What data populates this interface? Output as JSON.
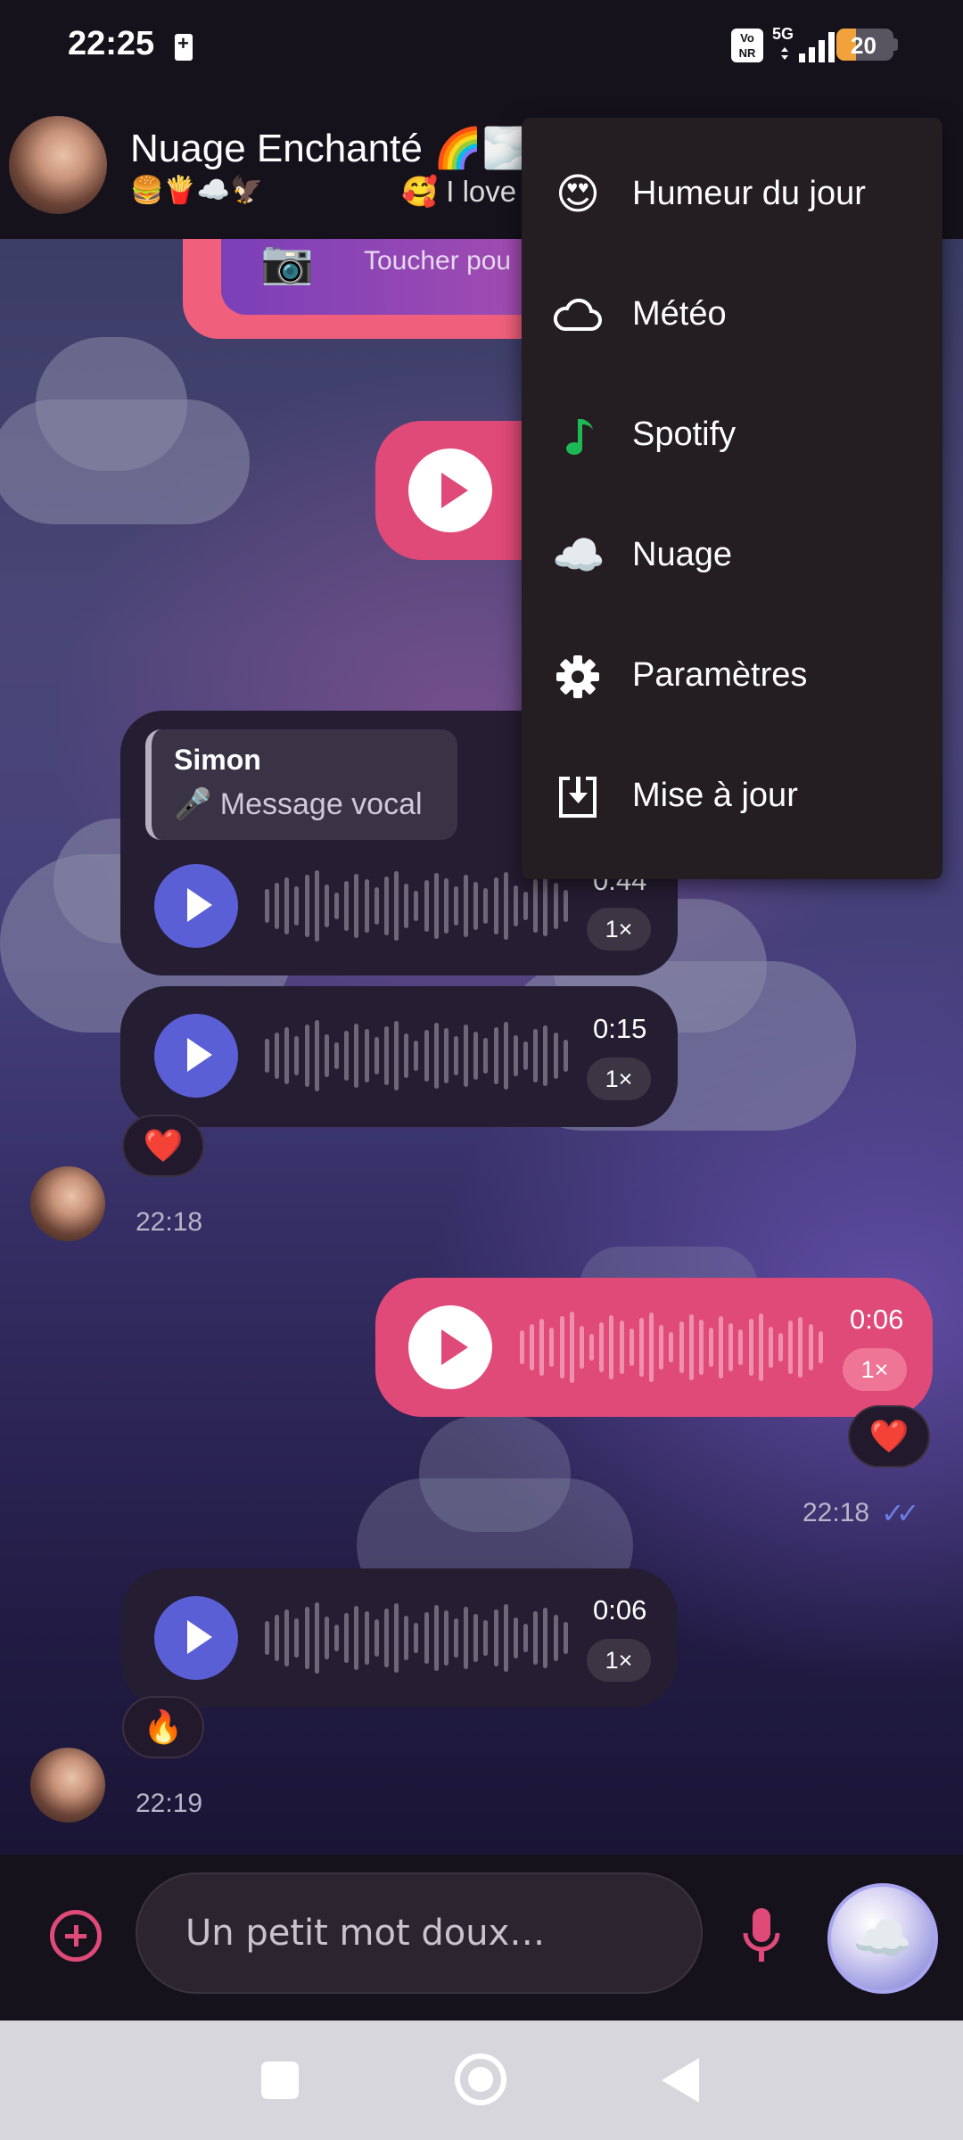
{
  "status_bar": {
    "time": "22:25",
    "volte": "Vo NR",
    "network": "5G",
    "battery": "20"
  },
  "chat_header": {
    "name": "Nuage Enchanté 🌈🌫️",
    "status_emojis": "🍔🍟☁️🦅",
    "last_message_snippet": "🥰 I love"
  },
  "messages": {
    "photo_hint": "Toucher pou",
    "reply": {
      "name": "Simon",
      "text": "🎤 Message vocal"
    },
    "voice_1": {
      "duration": "0:44",
      "speed": "1×"
    },
    "voice_2": {
      "duration": "0:15",
      "speed": "1×"
    },
    "voice_2_reaction": "❤️",
    "time_1": "22:18",
    "voice_3": {
      "duration": "0:06",
      "speed": "1×"
    },
    "voice_3_reaction": "❤️",
    "time_2": "22:18",
    "read_ticks": "✓✓",
    "voice_4": {
      "duration": "0:06",
      "speed": "1×"
    },
    "voice_4_reaction": "🔥",
    "time_3": "22:19"
  },
  "composer": {
    "placeholder": "Un petit mot doux…",
    "send_icon": "☁️"
  },
  "menu": {
    "items": [
      {
        "icon": "😍",
        "label": "Humeur du jour"
      },
      {
        "icon": "cloud-outline-icon",
        "label": "Météo"
      },
      {
        "icon": "music-note-icon",
        "label": "Spotify"
      },
      {
        "icon": "☁️",
        "label": "Nuage"
      },
      {
        "icon": "gear-icon",
        "label": "Paramètres"
      },
      {
        "icon": "download-box-icon",
        "label": "Mise à jour"
      }
    ]
  },
  "colors": {
    "accent_pink": "#e04a78",
    "accent_blue": "#5a5fd6",
    "spotify_green": "#1db954",
    "incoming_bubble": "#251d32",
    "menu_bg": "#241d22"
  }
}
